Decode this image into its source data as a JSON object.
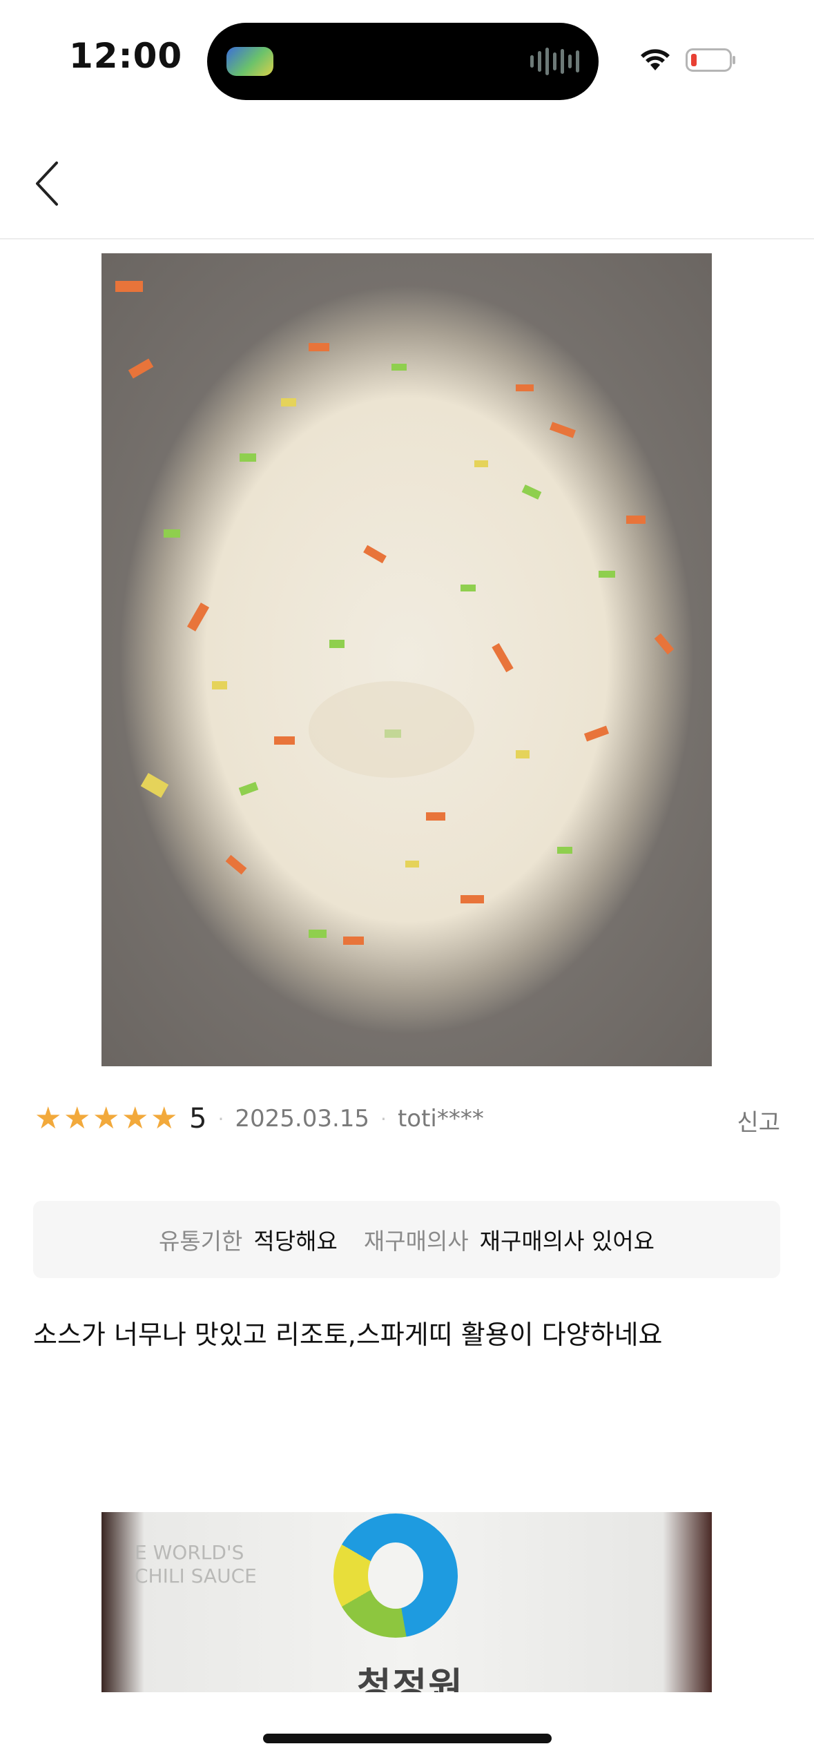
{
  "status_bar": {
    "time": "12:00"
  },
  "review": {
    "rating": "5",
    "date": "2025.03.15",
    "user": "toti****",
    "report_label": "신고",
    "star_color": "#f2a93b",
    "attributes": [
      {
        "label": "유통기한",
        "value": "적당해요"
      },
      {
        "label": "재구매의사",
        "value": "재구매의사 있어요"
      }
    ],
    "text": "소스가 너무나 맛있고 리조토,스파게띠 활용이 다양하네요"
  },
  "photo2": {
    "brand_ko": "청정원",
    "brand_en": "E WORLD'S\nCHILI SAUCE"
  },
  "icons": {
    "back": "chevron-left-icon",
    "wifi": "wifi-icon",
    "battery": "battery-low-icon",
    "star": "star-icon"
  }
}
